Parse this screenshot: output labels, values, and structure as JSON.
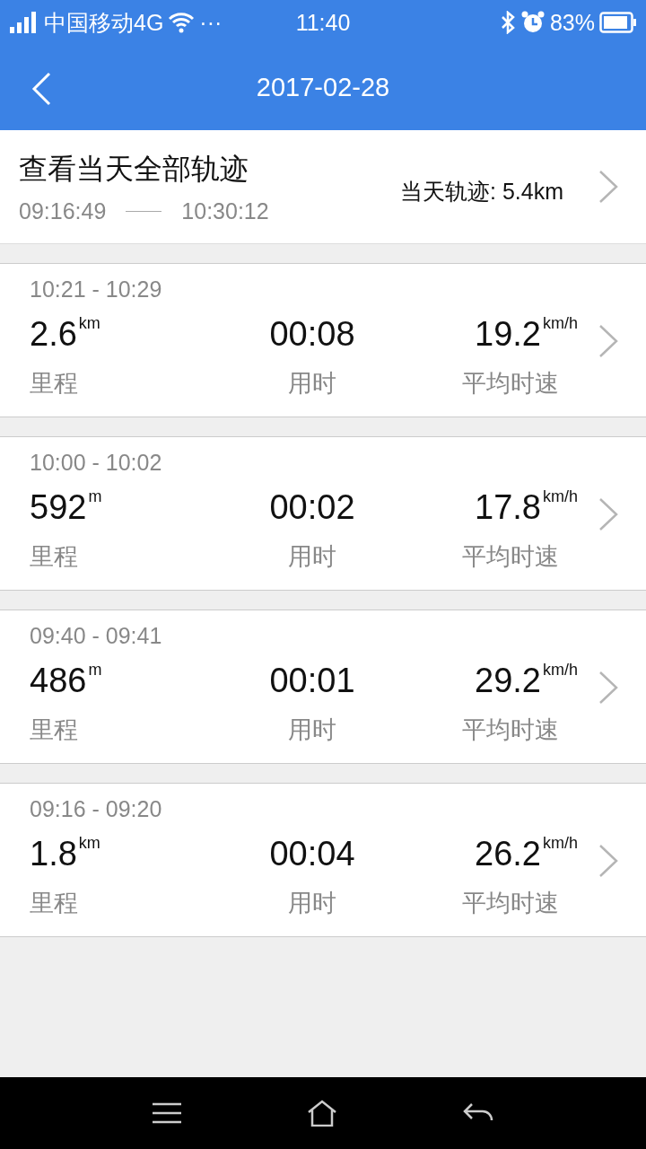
{
  "status_bar": {
    "carrier": "中国移动4G",
    "more": "···",
    "time": "11:40",
    "battery_percent": "83%"
  },
  "header": {
    "title": "2017-02-28"
  },
  "summary": {
    "title": "查看当天全部轨迹",
    "start": "09:16:49",
    "end": "10:30:12",
    "total": "当天轨迹: 5.4km"
  },
  "trips": [
    {
      "time_range": "10:21 - 10:29",
      "distance": "2.6",
      "distance_unit": "km",
      "duration": "00:08",
      "speed": "19.2",
      "speed_unit": "km/h",
      "distance_label": "里程",
      "duration_label": "用时",
      "speed_label": "平均时速"
    },
    {
      "time_range": "10:00 - 10:02",
      "distance": "592",
      "distance_unit": "m",
      "duration": "00:02",
      "speed": "17.8",
      "speed_unit": "km/h",
      "distance_label": "里程",
      "duration_label": "用时",
      "speed_label": "平均时速"
    },
    {
      "time_range": "09:40 - 09:41",
      "distance": "486",
      "distance_unit": "m",
      "duration": "00:01",
      "speed": "29.2",
      "speed_unit": "km/h",
      "distance_label": "里程",
      "duration_label": "用时",
      "speed_label": "平均时速"
    },
    {
      "time_range": "09:16 - 09:20",
      "distance": "1.8",
      "distance_unit": "km",
      "duration": "00:04",
      "speed": "26.2",
      "speed_unit": "km/h",
      "distance_label": "里程",
      "duration_label": "用时",
      "speed_label": "平均时速"
    }
  ]
}
